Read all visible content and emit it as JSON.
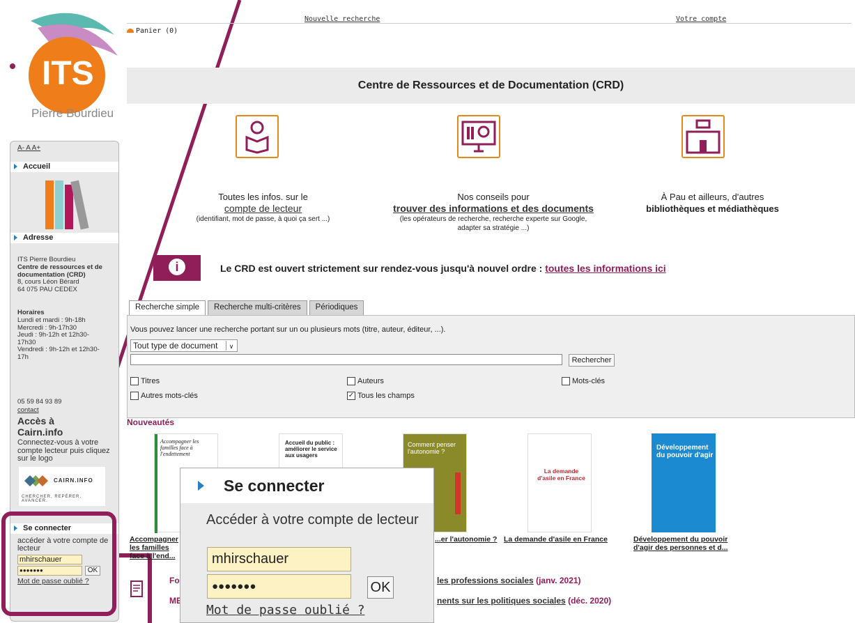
{
  "top_nav": {
    "new_search": "Nouvelle recherche",
    "account": "Votre compte",
    "cart": "Panier (0)"
  },
  "logo": {
    "brand": "ITS",
    "subtitle": "Pierre Bourdieu"
  },
  "sidebar": {
    "font_sizes": "A- A A+",
    "home_title": "Accueil",
    "address_title": "Adresse",
    "address_lines": [
      "ITS Pierre Bourdieu"
    ],
    "address_bold": "Centre de ressources et de documentation (CRD)",
    "address_street": "8, cours Léon Bérard",
    "address_city": "64 075 PAU CEDEX",
    "hours_title": "Horaires",
    "hours": "Lundi et mardi : 9h-18h\nMercredi : 9h-17h30\nJeudi : 9h-12h et 12h30-17h30\nVendredi : 9h-12h et 12h30-17h",
    "phone": "05 59 84 93 89",
    "contact": "contact",
    "cairn_title": "Accès à Cairn.info",
    "cairn_text": "Connectez-vous à votre compte lecteur puis cliquez sur le logo",
    "cairn_logo_text": "CAIRN.INFO",
    "cairn_tagline": "CHERCHER, REPÉRER, AVANCER.",
    "login_title": "Se connecter",
    "login_text": "accéder à votre compte de lecteur",
    "login_value": "mhirschauer",
    "password_mask": "●●●●●●●",
    "ok": "OK",
    "forgot": "Mot de passe oublié ?"
  },
  "main": {
    "crd_title": "Centre de Ressources et de Documentation (CRD)",
    "card1": {
      "line1": "Toutes les infos. sur le",
      "link": "compte de lecteur",
      "note": "(identifiant, mot de passe, à quoi ça sert ...)"
    },
    "card2": {
      "line1": "Nos conseils pour",
      "link": "trouver des informations et des documents",
      "note": "(les opérateurs de recherche, recherche experte sur Google, adapter sa stratégie ...)"
    },
    "card3": {
      "line1": "À Pau et ailleurs, d'autres",
      "bold": "bibliothèques et médiathèques"
    },
    "info_text": "Le CRD est ouvert strictement sur rendez-vous jusqu'à nouvel ordre : ",
    "info_link": "toutes les informations ici"
  },
  "search": {
    "tabs": [
      "Recherche simple",
      "Recherche multi-critères",
      "Périodiques"
    ],
    "hint": "Vous pouvez lancer une recherche portant sur un ou plusieurs mots (titre, auteur, éditeur, ...).",
    "doc_type": "Tout type de document",
    "button": "Rechercher",
    "checks": [
      "Titres",
      "Auteurs",
      "Mots-clés",
      "Autres mots-clés",
      "Tous les champs"
    ]
  },
  "news": {
    "title": "Nouveautés",
    "books": [
      {
        "title": "Accompagner les familles face à l'endettement",
        "label": "Accompagner les familles face à l'end..."
      },
      {
        "title": "Accueil du public : améliorer le service aux usagers",
        "label": "Accueil du public : améliorer le service aux usagers"
      },
      {
        "title": "Comment penser l'autonomie ?",
        "label": "...er l'autonomie ?"
      },
      {
        "title": "La demande d'asile en France",
        "label": "La demande d'asile en France"
      },
      {
        "title": "Développement du pouvoir d'agir",
        "label": "Développement du pouvoir d'agir des personnes et d..."
      }
    ],
    "line1_prefix": "Fo",
    "line1": "les professions sociales",
    "line1_date": "(janv. 2021)",
    "line2_prefix": "ME",
    "line2": "nents sur les politiques sociales",
    "line2_date": "(déc. 2020)"
  },
  "zoom": {
    "title": "Se connecter",
    "text": "Accéder à votre compte de lecteur",
    "login_value": "mhirschauer",
    "password_mask": "●●●●●●●",
    "ok": "OK",
    "forgot": "Mot de passe oublié ?"
  },
  "colors": {
    "accent": "#8f1e59",
    "orange": "#e08a1e",
    "blue": "#2a7fc0"
  }
}
